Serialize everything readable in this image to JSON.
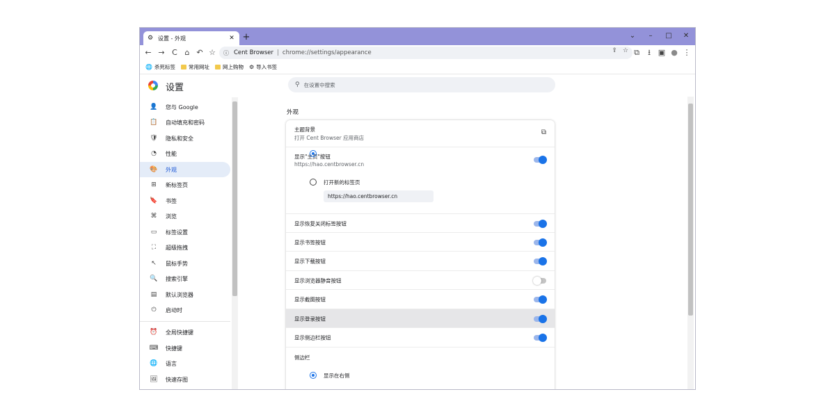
{
  "tab": {
    "icon": "gear-icon",
    "title": "设置 - 外观",
    "close": "✕"
  },
  "newtab": "+",
  "window_controls": {
    "dropdown": "⌄",
    "minimize": "–",
    "maximize": "□",
    "close": "✕"
  },
  "toolbar": {
    "back": "←",
    "forward": "→",
    "reload": "C",
    "home": "⌂",
    "undo": "↶",
    "star": "☆"
  },
  "omnibox": {
    "site": "Cent Browser",
    "separator": "|",
    "url": "chrome://settings/appearance"
  },
  "toolbar_right": {
    "share": "⇪",
    "star": "☆",
    "crop": "⧉",
    "download": "⭳",
    "sidebar": "▣",
    "account": "●",
    "menu": "⋮"
  },
  "bookmarks": [
    {
      "icon": "globe-icon",
      "label": "杀死标签"
    },
    {
      "icon": "folder-icon",
      "label": "常用网址"
    },
    {
      "icon": "folder-icon",
      "label": "网上购物"
    },
    {
      "icon": "gear-icon",
      "label": "导入书签"
    }
  ],
  "settings": {
    "title": "设置",
    "search_placeholder": "在设置中搜索"
  },
  "sidebar": {
    "items": [
      {
        "icon": "👤",
        "label": "您与 Google"
      },
      {
        "icon": "📋",
        "label": "自动填充和密码"
      },
      {
        "icon": "🛡",
        "label": "隐私和安全"
      },
      {
        "icon": "◔",
        "label": "性能"
      },
      {
        "icon": "🎨",
        "label": "外观",
        "active": true
      },
      {
        "icon": "⊞",
        "label": "新标签页"
      },
      {
        "icon": "🔖",
        "label": "书签"
      },
      {
        "icon": "⌘",
        "label": "浏览"
      },
      {
        "icon": "▭",
        "label": "标签设置"
      },
      {
        "icon": "⛶",
        "label": "超级拖拽"
      },
      {
        "icon": "↖",
        "label": "鼠标手势"
      },
      {
        "icon": "🔍",
        "label": "搜索引擎"
      },
      {
        "icon": "▤",
        "label": "默认浏览器"
      },
      {
        "icon": "⏻",
        "label": "启动时"
      },
      {
        "icon": "⏰",
        "label": "全局快捷键"
      },
      {
        "icon": "⌨",
        "label": "快捷键"
      },
      {
        "icon": "🌐",
        "label": "语言"
      },
      {
        "icon": "🖼",
        "label": "快速存图"
      }
    ]
  },
  "main": {
    "section_title": "外观",
    "theme": {
      "title": "主题背景",
      "subtitle": "打开 Cent Browser 应用商店",
      "icon": "external-link-icon"
    },
    "home_button": {
      "title": "显示\"主页\"按钮",
      "subtitle": "https://hao.centbrowser.cn",
      "enabled": true
    },
    "home_options": [
      {
        "label": "打开新的标签页",
        "selected": false
      },
      {
        "value": "https://hao.centbrowser.cn",
        "selected": true
      }
    ],
    "toggles": [
      {
        "label": "显示恢复关闭标签按钮",
        "enabled": true
      },
      {
        "label": "显示书签按钮",
        "enabled": true
      },
      {
        "label": "显示下载按钮",
        "enabled": true
      },
      {
        "label": "显示浏览器静音按钮",
        "enabled": false
      },
      {
        "label": "显示截图按钮",
        "enabled": true
      },
      {
        "label": "显示登录按钮",
        "enabled": true,
        "hover": true
      },
      {
        "label": "显示侧边栏按钮",
        "enabled": true
      }
    ],
    "sidebar_section": {
      "title": "侧边栏",
      "option": "显示在右侧",
      "selected": true
    }
  }
}
